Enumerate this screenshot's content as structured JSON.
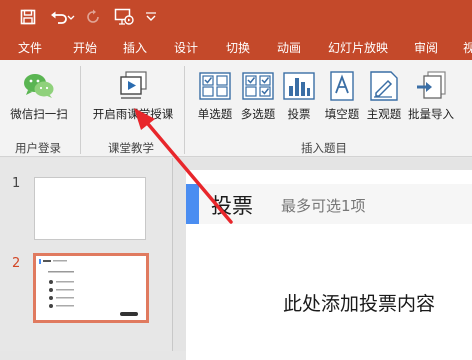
{
  "ribbon_tabs": [
    "文件",
    "开始",
    "插入",
    "设计",
    "切换",
    "动画",
    "幻灯片放映",
    "审阅",
    "视"
  ],
  "groups": {
    "user_login": {
      "label": "用户登录",
      "buttons": [
        {
          "label": "微信扫一扫",
          "icon": "wechat-icon"
        }
      ]
    },
    "classroom": {
      "label": "课堂教学",
      "buttons": [
        {
          "label": "开启雨课堂授课",
          "icon": "start-class-icon"
        }
      ]
    },
    "insert_question": {
      "label": "插入题目",
      "buttons": [
        {
          "label": "单选题",
          "icon": "single-choice-icon"
        },
        {
          "label": "多选题",
          "icon": "multi-choice-icon"
        },
        {
          "label": "投票",
          "icon": "vote-icon"
        },
        {
          "label": "填空题",
          "icon": "fill-blank-icon"
        },
        {
          "label": "主观题",
          "icon": "subjective-icon"
        },
        {
          "label": "批量导入",
          "icon": "batch-import-icon"
        }
      ]
    }
  },
  "slides": {
    "numbers": [
      "1",
      "2"
    ],
    "selected": "2"
  },
  "slide": {
    "title": "投票",
    "subtitle": "最多可选1项",
    "body": "此处添加投票内容"
  },
  "colors": {
    "accent": "#c4492a",
    "ribbon": "#f3f3f3",
    "slide_bar": "#4a8df1",
    "selected_border": "#e07a5f",
    "arrow": "#e8262b"
  }
}
